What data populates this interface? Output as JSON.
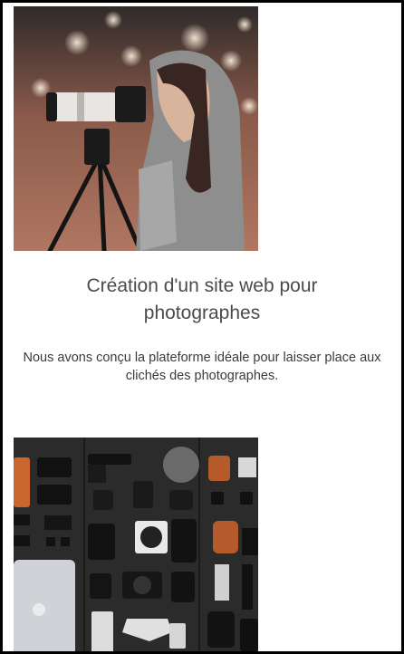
{
  "project": {
    "title": "Création d'un site web pour photographes",
    "description": "Nous avons conçu la plateforme idéale pour laisser place aux clichés des photographes."
  },
  "images": {
    "photographer": {
      "alt": "Photographe avec appareil sur trépied"
    },
    "gear": {
      "alt": "Matériel photo sur un mur noir"
    }
  }
}
